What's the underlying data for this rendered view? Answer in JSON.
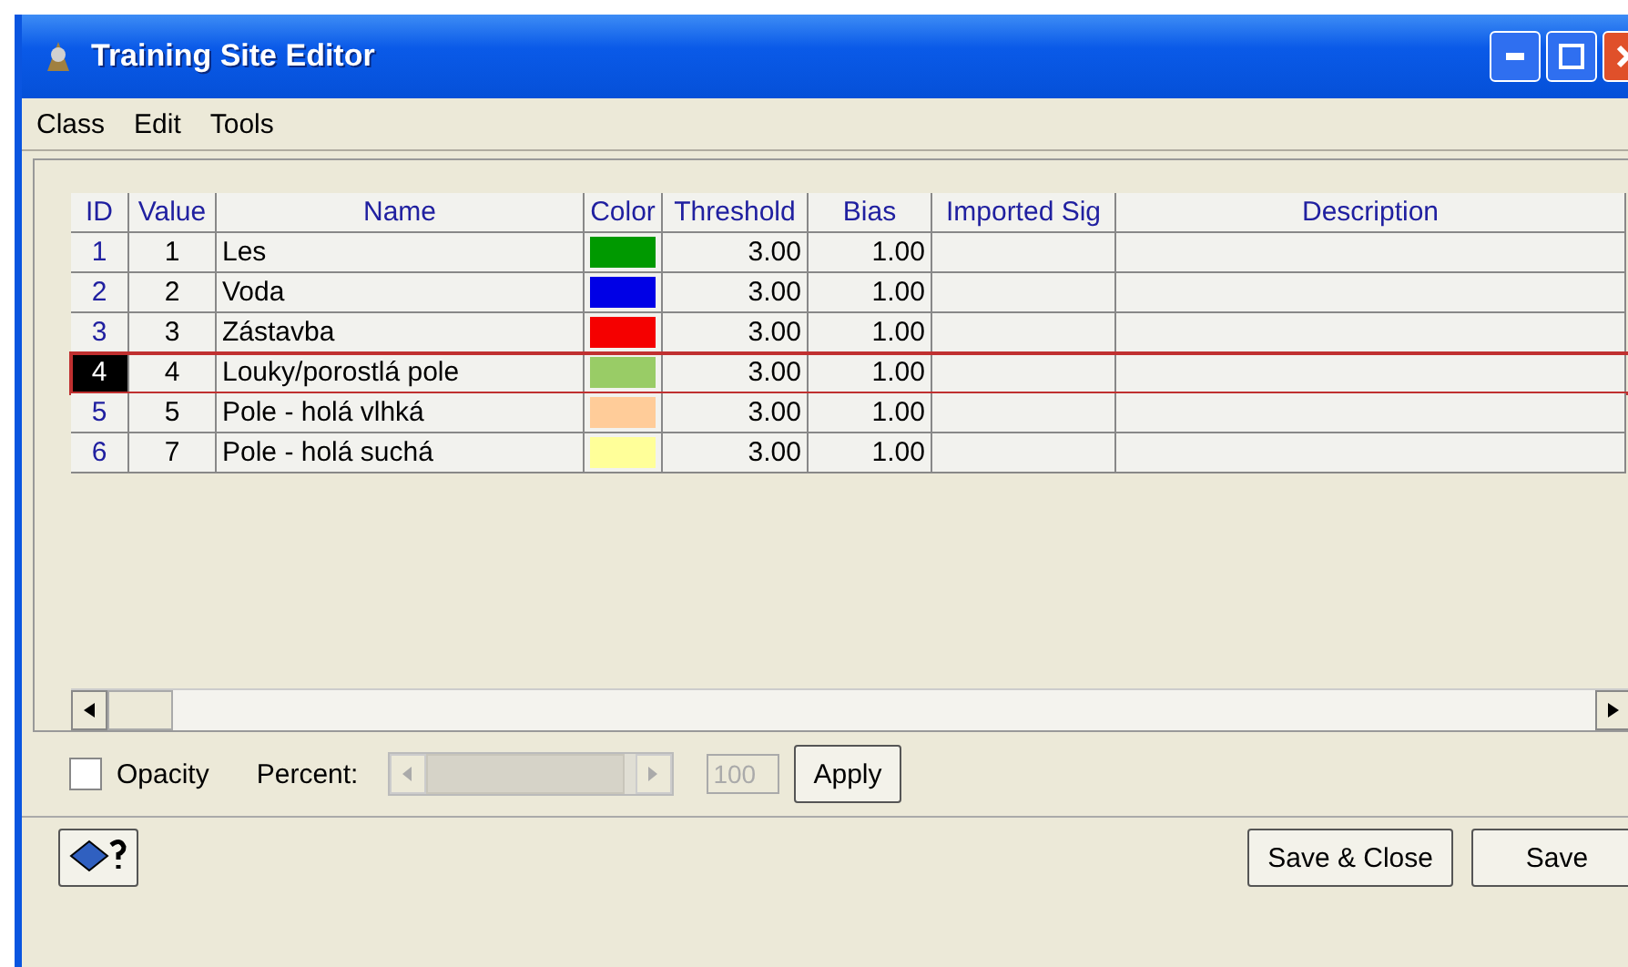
{
  "window": {
    "title": "Training Site Editor"
  },
  "menu": [
    "Class",
    "Edit",
    "Tools"
  ],
  "table": {
    "columns": [
      "ID",
      "Value",
      "Name",
      "Color",
      "Threshold",
      "Bias",
      "Imported Sig",
      "Description"
    ],
    "rows": [
      {
        "id": "1",
        "value": "1",
        "name": "Les",
        "color": "#009900",
        "threshold": "3.00",
        "bias": "1.00",
        "selected": false
      },
      {
        "id": "2",
        "value": "2",
        "name": "Voda",
        "color": "#0000e6",
        "threshold": "3.00",
        "bias": "1.00",
        "selected": false
      },
      {
        "id": "3",
        "value": "3",
        "name": "Zástavba",
        "color": "#f50000",
        "threshold": "3.00",
        "bias": "1.00",
        "selected": false
      },
      {
        "id": "4",
        "value": "4",
        "name": "Louky/porostlá pole",
        "color": "#99cc66",
        "threshold": "3.00",
        "bias": "1.00",
        "selected": true
      },
      {
        "id": "5",
        "value": "5",
        "name": "Pole - holá vlhká",
        "color": "#ffcc99",
        "threshold": "3.00",
        "bias": "1.00",
        "selected": false
      },
      {
        "id": "6",
        "value": "7",
        "name": "Pole - holá suchá",
        "color": "#ffff99",
        "threshold": "3.00",
        "bias": "1.00",
        "selected": false
      }
    ]
  },
  "opacity": {
    "label": "Opacity",
    "checked": false,
    "percent_label": "Percent:",
    "percent_value": "100",
    "apply": "Apply"
  },
  "buttons": [
    "Save & Close",
    "Save"
  ]
}
